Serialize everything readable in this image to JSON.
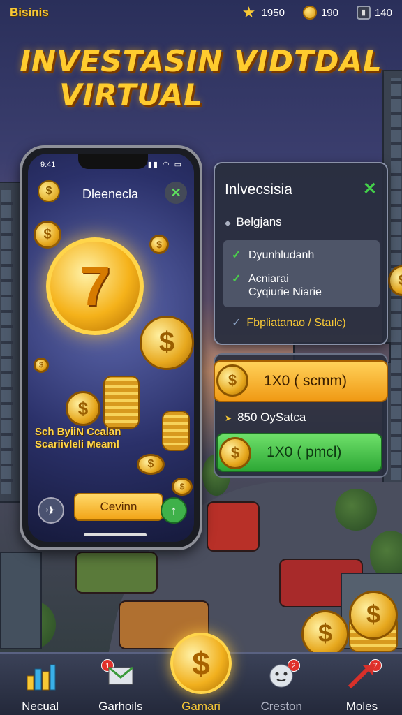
{
  "topbar": {
    "brand": "Bisinis",
    "stats": [
      {
        "icon": "star-icon",
        "value": "1950"
      },
      {
        "icon": "coin-icon",
        "value": "190"
      },
      {
        "icon": "box-icon",
        "value": "140"
      }
    ]
  },
  "title": {
    "line1": "INVESTASIN VIDTDAL",
    "line2": "VIRTUAL"
  },
  "phone": {
    "status_time": "9:41",
    "status_icons": "▮▮ ◠ ▭",
    "app_title": "Dleenecla",
    "promo_line1": "Sch ByiiN Ccalan",
    "promo_line2": "Scariivleli Meaml",
    "action_label": "Cevinn"
  },
  "panel": {
    "title": "Inlvecsisia",
    "subtitle": "Belgjans",
    "options": [
      {
        "line1": "Dyunhludanh",
        "line2": ""
      },
      {
        "line1": "Acniarai",
        "line2": "Cyqiurie Niarie"
      }
    ],
    "footer": "Fbpliatanao / Staılc)"
  },
  "actions": {
    "orange_label": "1X0 ( scmm)",
    "info": "850 OySatca",
    "green_label": "1X0 ( pmcl)"
  },
  "nav": {
    "items": [
      {
        "label": "Necual",
        "badge": ""
      },
      {
        "label": "Garhoils",
        "badge": "1"
      },
      {
        "label": "Gamari",
        "badge": ""
      },
      {
        "label": "Creston",
        "badge": "2"
      },
      {
        "label": "Moles",
        "badge": "7"
      }
    ]
  },
  "colors": {
    "accent_gold": "#f7c836",
    "accent_green": "#43d04a",
    "panel_bg": "#282e3e"
  }
}
